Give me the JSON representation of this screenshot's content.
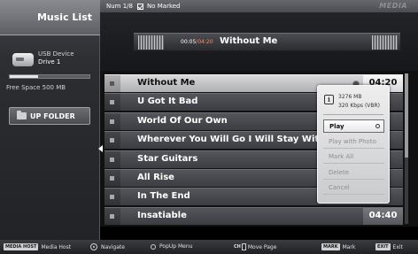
{
  "sidebar": {
    "title": "Music List",
    "device_label": "USB Device",
    "device_name": "Drive 1",
    "storage_used_fraction": 0.35,
    "free_space": "Free Space 500 MB",
    "up_folder_label": "UP FOLDER"
  },
  "topbar": {
    "num": "Num 1/8",
    "marked": "No Marked",
    "brand_logo": "MEDIA"
  },
  "now_playing": {
    "elapsed": "00:05",
    "total": "/04:20",
    "title": "Without Me"
  },
  "list": {
    "rows": [
      {
        "title": "Without Me",
        "duration": "04:20",
        "selected": true,
        "playing": true
      },
      {
        "title": "U Got It Bad",
        "duration": "",
        "selected": false,
        "playing": false
      },
      {
        "title": "World Of Our Own",
        "duration": "",
        "selected": false,
        "playing": false
      },
      {
        "title": "Wherever You Will Go I Will Stay With",
        "duration": "",
        "selected": false,
        "playing": false
      },
      {
        "title": "Star Guitars",
        "duration": "",
        "selected": false,
        "playing": false
      },
      {
        "title": "All Rise",
        "duration": "",
        "selected": false,
        "playing": false
      },
      {
        "title": "In The End",
        "duration": "",
        "selected": false,
        "playing": false
      },
      {
        "title": "Insatiable",
        "duration": "04:40",
        "selected": false,
        "playing": false
      }
    ],
    "scroll_fraction": 0.56
  },
  "popup": {
    "file_size": "3276 MB",
    "bitrate": "320 Kbps (VBR)",
    "items": [
      "Play",
      "Play with Photo",
      "Mark All",
      "Delete",
      "Cancel"
    ],
    "active_index": 0
  },
  "bottombar": {
    "media_host_key": "MEDIA HOST",
    "media_host": "Media Host",
    "navigate": "Navigate",
    "popup_menu": "PopUp Menu",
    "ch_key": "CH",
    "move_page": "Move Page",
    "mark_key": "MARK",
    "mark": "Mark",
    "exit_key": "EXIT",
    "exit": "Exit"
  }
}
